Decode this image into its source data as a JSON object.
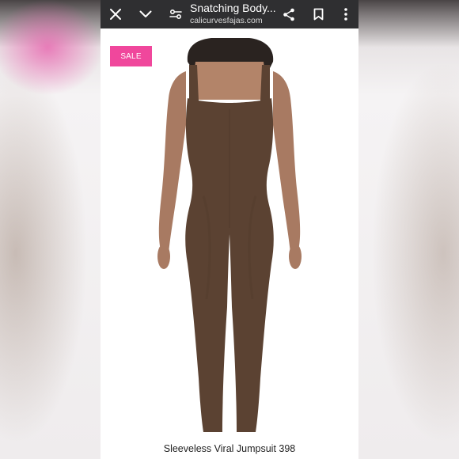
{
  "browser": {
    "page_title": "Snatching Body...",
    "url": "calicurvesfajas.com",
    "icons": [
      "close-icon",
      "chevron-down-icon",
      "page-settings-icon",
      "share-icon",
      "bookmark-icon",
      "more-vert-icon"
    ]
  },
  "product": {
    "badge": "SALE",
    "title": "Sleeveless Viral Jumpsuit 398"
  },
  "colors": {
    "toolbar_bg": "#2f2f31",
    "badge_bg": "#f0479c",
    "garment": "#5b4232"
  }
}
